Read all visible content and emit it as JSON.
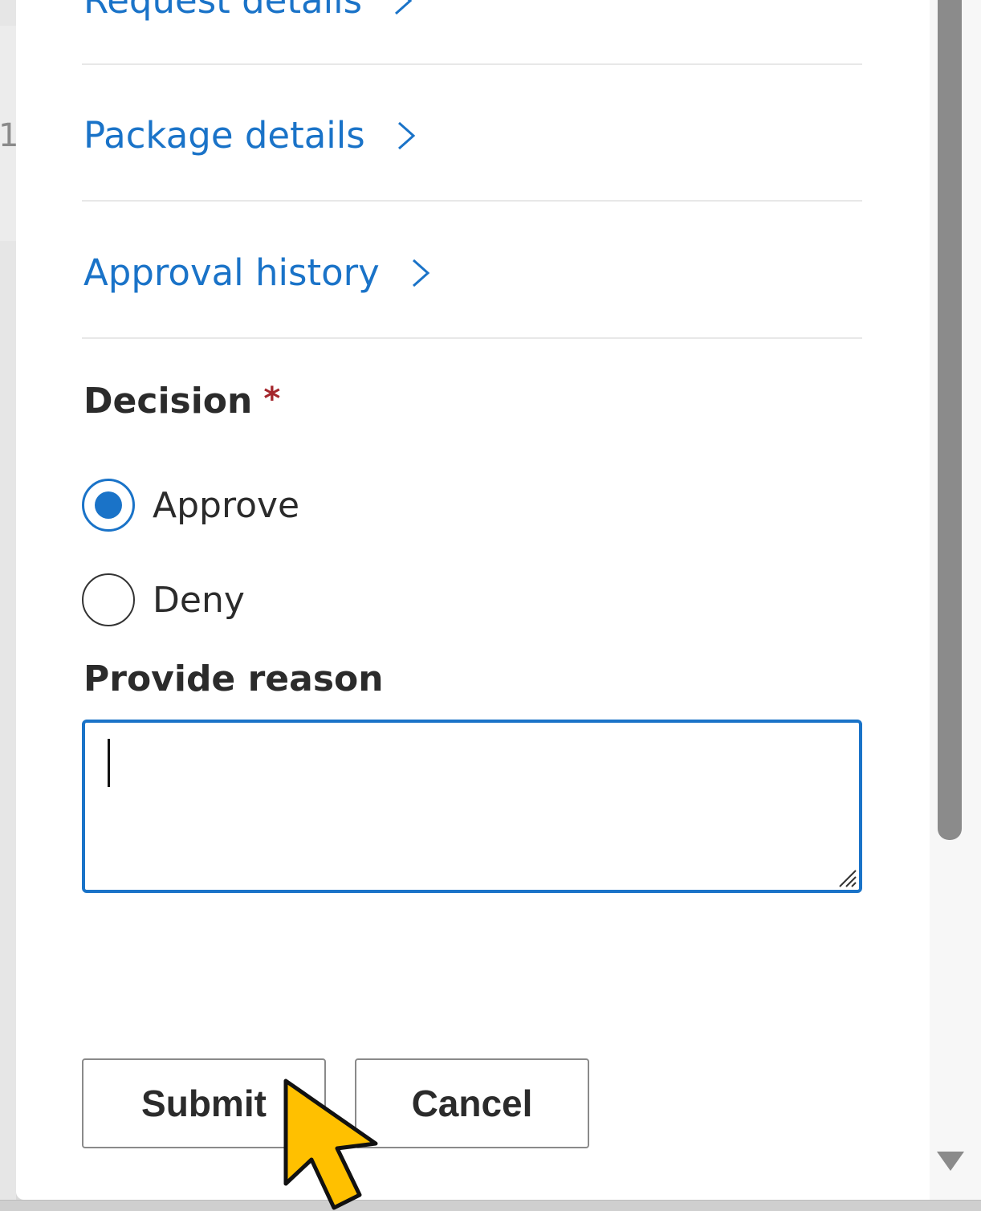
{
  "links": {
    "request_details": "Request details",
    "package_details": "Package details",
    "approval_history": "Approval history"
  },
  "background": {
    "partial_text": "1"
  },
  "decision": {
    "label": "Decision",
    "required_marker": "*",
    "options": [
      {
        "label": "Approve",
        "selected": true
      },
      {
        "label": "Deny",
        "selected": false
      }
    ]
  },
  "reason": {
    "label": "Provide reason",
    "value": ""
  },
  "actions": {
    "submit_label": "Submit",
    "cancel_label": "Cancel"
  },
  "colors": {
    "accent": "#1a73c8",
    "required": "#a4262c",
    "cursor_fill": "#ffc000"
  }
}
